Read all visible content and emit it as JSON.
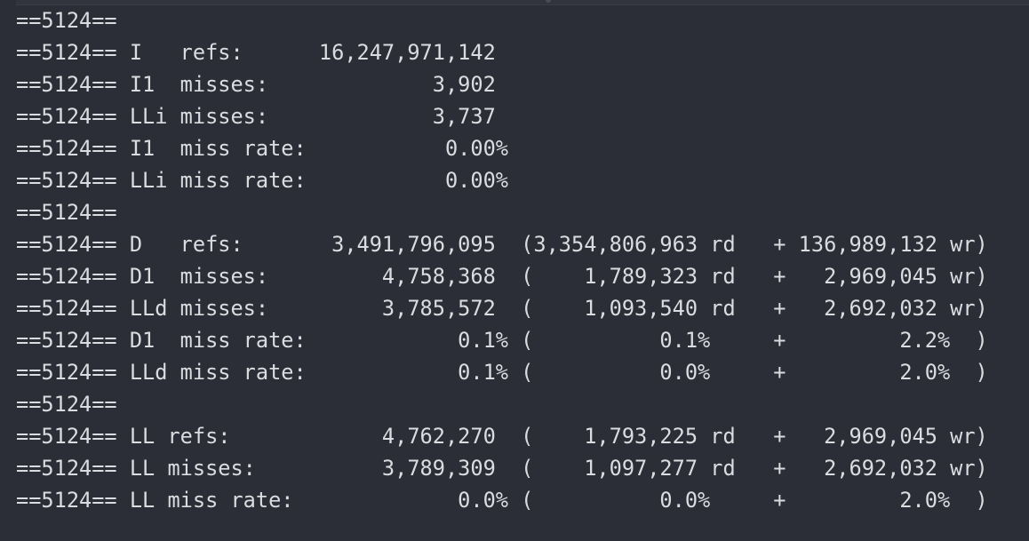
{
  "terminal": {
    "lines": [
      "==5124==",
      "==5124== I   refs:      16,247,971,142",
      "==5124== I1  misses:             3,902",
      "==5124== LLi misses:             3,737",
      "==5124== I1  miss rate:           0.00%",
      "==5124== LLi miss rate:           0.00%",
      "==5124==",
      "==5124== D   refs:       3,491,796,095  (3,354,806,963 rd   + 136,989,132 wr)",
      "==5124== D1  misses:         4,758,368  (    1,789,323 rd   +   2,969,045 wr)",
      "==5124== LLd misses:         3,785,572  (    1,093,540 rd   +   2,692,032 wr)",
      "==5124== D1  miss rate:            0.1% (          0.1%     +         2.2%  )",
      "==5124== LLd miss rate:            0.1% (          0.0%     +         2.0%  )",
      "==5124==",
      "==5124== LL refs:            4,762,270  (    1,793,225 rd   +   2,969,045 wr)",
      "==5124== LL misses:          3,789,309  (    1,097,277 rd   +   2,692,032 wr)",
      "==5124== LL miss rate:             0.0% (          0.0%     +         2.0%  )"
    ]
  }
}
